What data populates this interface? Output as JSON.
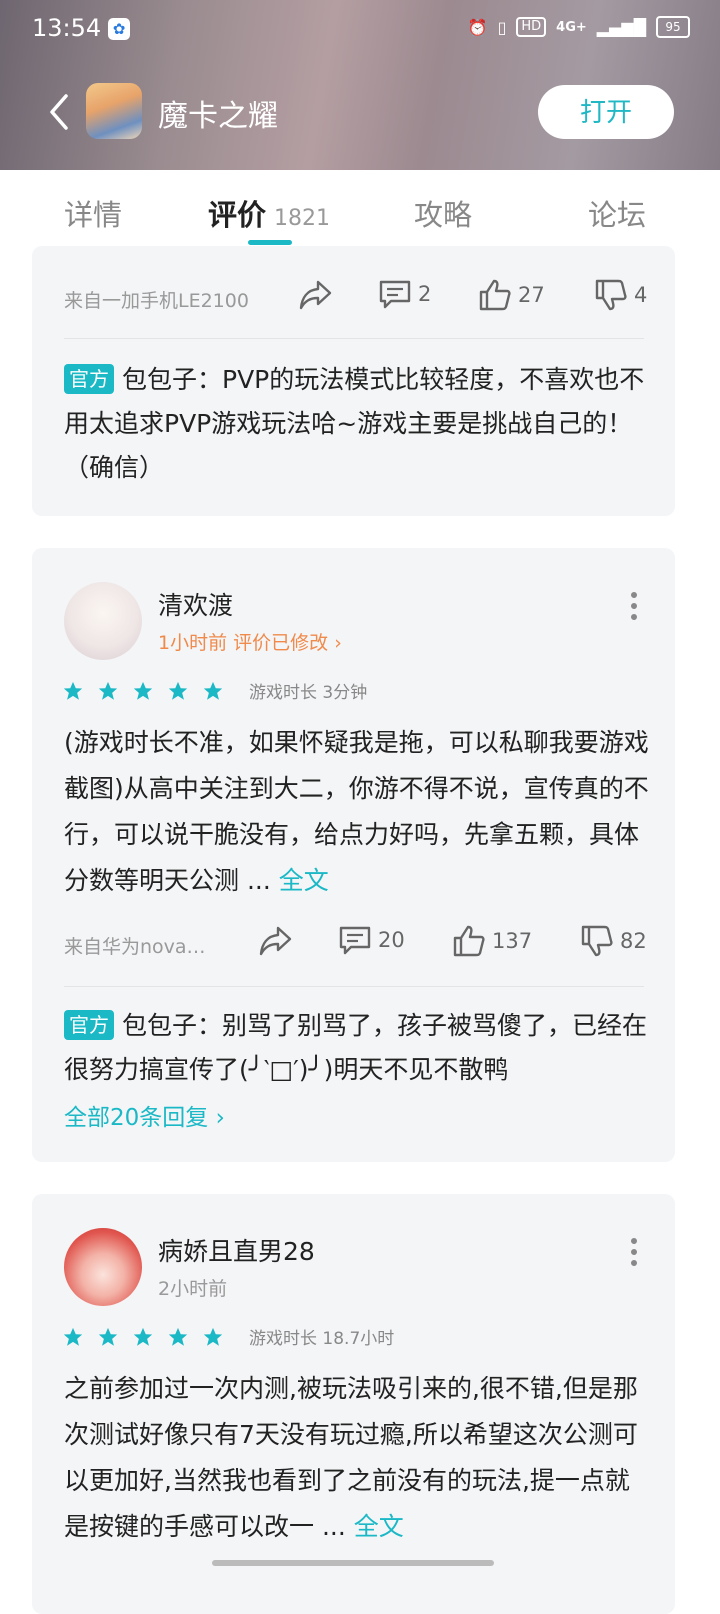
{
  "status_bar": {
    "time": "13:54",
    "hd": "HD",
    "network": "4G+",
    "battery": "95"
  },
  "header": {
    "app_title": "魔卡之耀",
    "open_button": "打开"
  },
  "tabs": [
    {
      "label": "详情"
    },
    {
      "label": "评价",
      "count": "1821"
    },
    {
      "label": "攻略"
    },
    {
      "label": "论坛"
    }
  ],
  "review0": {
    "device": "来自一加手机LE2100",
    "comments": "2",
    "likes": "27",
    "dislikes": "4",
    "official_tag": "官方",
    "official_reply": "包包子：PVP的玩法模式比较轻度，不喜欢也不用太追求PVP游戏玩法哈~游戏主要是挑战自己的！（确信）"
  },
  "review1": {
    "username": "清欢渡",
    "time": "1小时前",
    "modified": "评价已修改",
    "stars": 5,
    "playtime": "游戏时长 3分钟",
    "body": "(游戏时长不准，如果怀疑我是拖，可以私聊我要游戏截图)从高中关注到大二，你游不得不说，宣传真的不行，可以说干脆没有，给点力好吗，先拿五颗，具体分数等明天公测 ...",
    "full_text": "全文",
    "device": "来自华为nova…",
    "comments": "20",
    "likes": "137",
    "dislikes": "82",
    "official_tag": "官方",
    "official_reply": "包包子：别骂了别骂了，孩子被骂傻了，已经在很努力搞宣传了(╯‵□′)╯)明天不见不散鸭",
    "all_replies": "全部20条回复"
  },
  "review2": {
    "username": "病娇且直男28",
    "time": "2小时前",
    "stars": 5,
    "playtime": "游戏时长 18.7小时",
    "body": "之前参加过一次内测,被玩法吸引来的,很不错,但是那次测试好像只有7天没有玩过瘾,所以希望这次公测可以更加好,当然我也看到了之前没有的玩法,提一点就是按键的手感可以改一 ...",
    "full_text": "全文"
  },
  "colors": {
    "accent": "#1bb8c6",
    "orange": "#f08a4b",
    "card_bg": "#f4f5f7"
  },
  "icons": [
    "back-arrow-icon",
    "share-icon",
    "comment-icon",
    "thumbs-up-icon",
    "thumbs-down-icon",
    "star-icon",
    "more-icon",
    "chevron-right-icon"
  ]
}
